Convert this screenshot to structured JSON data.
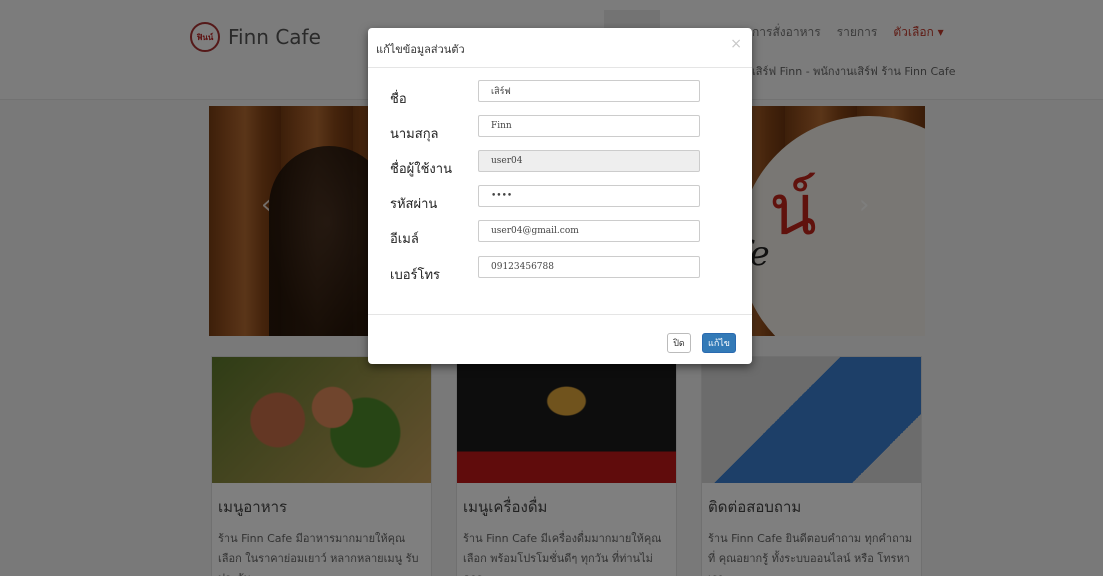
{
  "navbar": {
    "brand": "Finn Cafe",
    "logo_text": "ฟินน์",
    "menu": [
      "การสั่งอาหาร",
      "รายการ",
      "ตัวเลือก ▾"
    ],
    "subtitle": "เสิร์ฟ Finn - พนักงานเสิร์ฟ ร้าน Finn Cafe"
  },
  "carousel": {
    "logo_char": "น์",
    "logo_script": "fe"
  },
  "cards": [
    {
      "title": "เมนูอาหาร",
      "text": "ร้าน Finn Cafe มีอาหารมากมายให้คุณเลือก ในราคาย่อมเยาว์ หลากหลายเมนู รับประกัน"
    },
    {
      "title": "เมนูเครื่องดื่ม",
      "text": "ร้าน Finn Cafe มีเครื่องดื่มมากมายให้คุณ เลือก พร้อมโปรโมชั่นดีๆ ทุกวัน ที่ท่านไม่ควร"
    },
    {
      "title": "ติดต่อสอบถาม",
      "text": "ร้าน Finn Cafe ยินดีตอบคำถาม ทุกคำถามที่ คุณอยากรู้ ทั้งระบบออนไลน์ หรือ โทรหาเรา"
    }
  ],
  "modal": {
    "title": "แก้ไขข้อมูลส่วนตัว",
    "close_symbol": "×",
    "fields": [
      {
        "label": "ชื่อ",
        "value": "เสิร์ฟ"
      },
      {
        "label": "นามสกุล",
        "value": "Finn"
      },
      {
        "label": "ชื่อผู้ใช้งาน",
        "value": "user04"
      },
      {
        "label": "รหัสผ่าน",
        "value": "••••"
      },
      {
        "label": "อีเมล์",
        "value": "user04@gmail.com"
      },
      {
        "label": "เบอร์โทร",
        "value": "09123456788"
      }
    ],
    "close_button": "ปิด",
    "save_button": "แก้ไข"
  }
}
